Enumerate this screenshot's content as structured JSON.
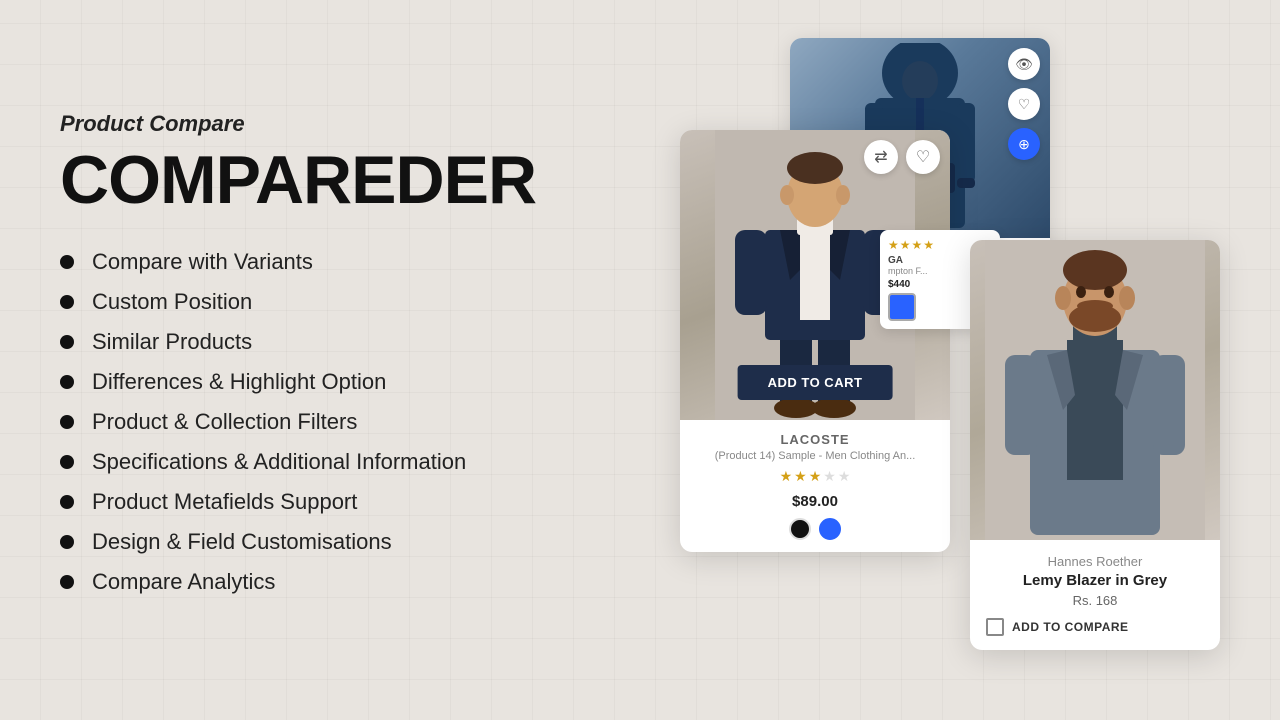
{
  "header": {
    "subtitle": "Product Compare",
    "title": "COMPAREDER"
  },
  "features": [
    {
      "id": "compare-variants",
      "label": "Compare with Variants"
    },
    {
      "id": "custom-position",
      "label": "Custom Position"
    },
    {
      "id": "similar-products",
      "label": "Similar Products"
    },
    {
      "id": "differences-highlight",
      "label": "Differences & Highlight Option"
    },
    {
      "id": "product-collection-filters",
      "label": "Product & Collection Filters"
    },
    {
      "id": "specifications-additional",
      "label": "Specifications & Additional Information"
    },
    {
      "id": "product-metafields",
      "label": "Product Metafields Support"
    },
    {
      "id": "design-field",
      "label": "Design & Field Customisations"
    },
    {
      "id": "compare-analytics",
      "label": "Compare Analytics"
    }
  ],
  "product_card_1": {
    "brand": "LACOSTE",
    "product_name": "(Product 14) Sample - Men Clothing An...",
    "price": "$89.00",
    "stars": [
      true,
      true,
      true,
      false,
      false
    ],
    "colors": [
      "#111111",
      "#2962ff"
    ],
    "add_to_cart_label": "ADD TO CART"
  },
  "product_card_2": {
    "brand": "Hannes Roether",
    "title": "Lemy Blazer in Grey",
    "price": "Rs. 168",
    "add_to_compare_label": "ADD TO COMPARE"
  },
  "ga_snippet": {
    "brand": "GA",
    "product": "mpton F...",
    "price": "$440",
    "stars": [
      "★",
      "★",
      "★",
      "★"
    ]
  },
  "icons": {
    "eye": "👁",
    "heart": "♡",
    "compare": "⇄",
    "compare_blue": "⊕"
  }
}
